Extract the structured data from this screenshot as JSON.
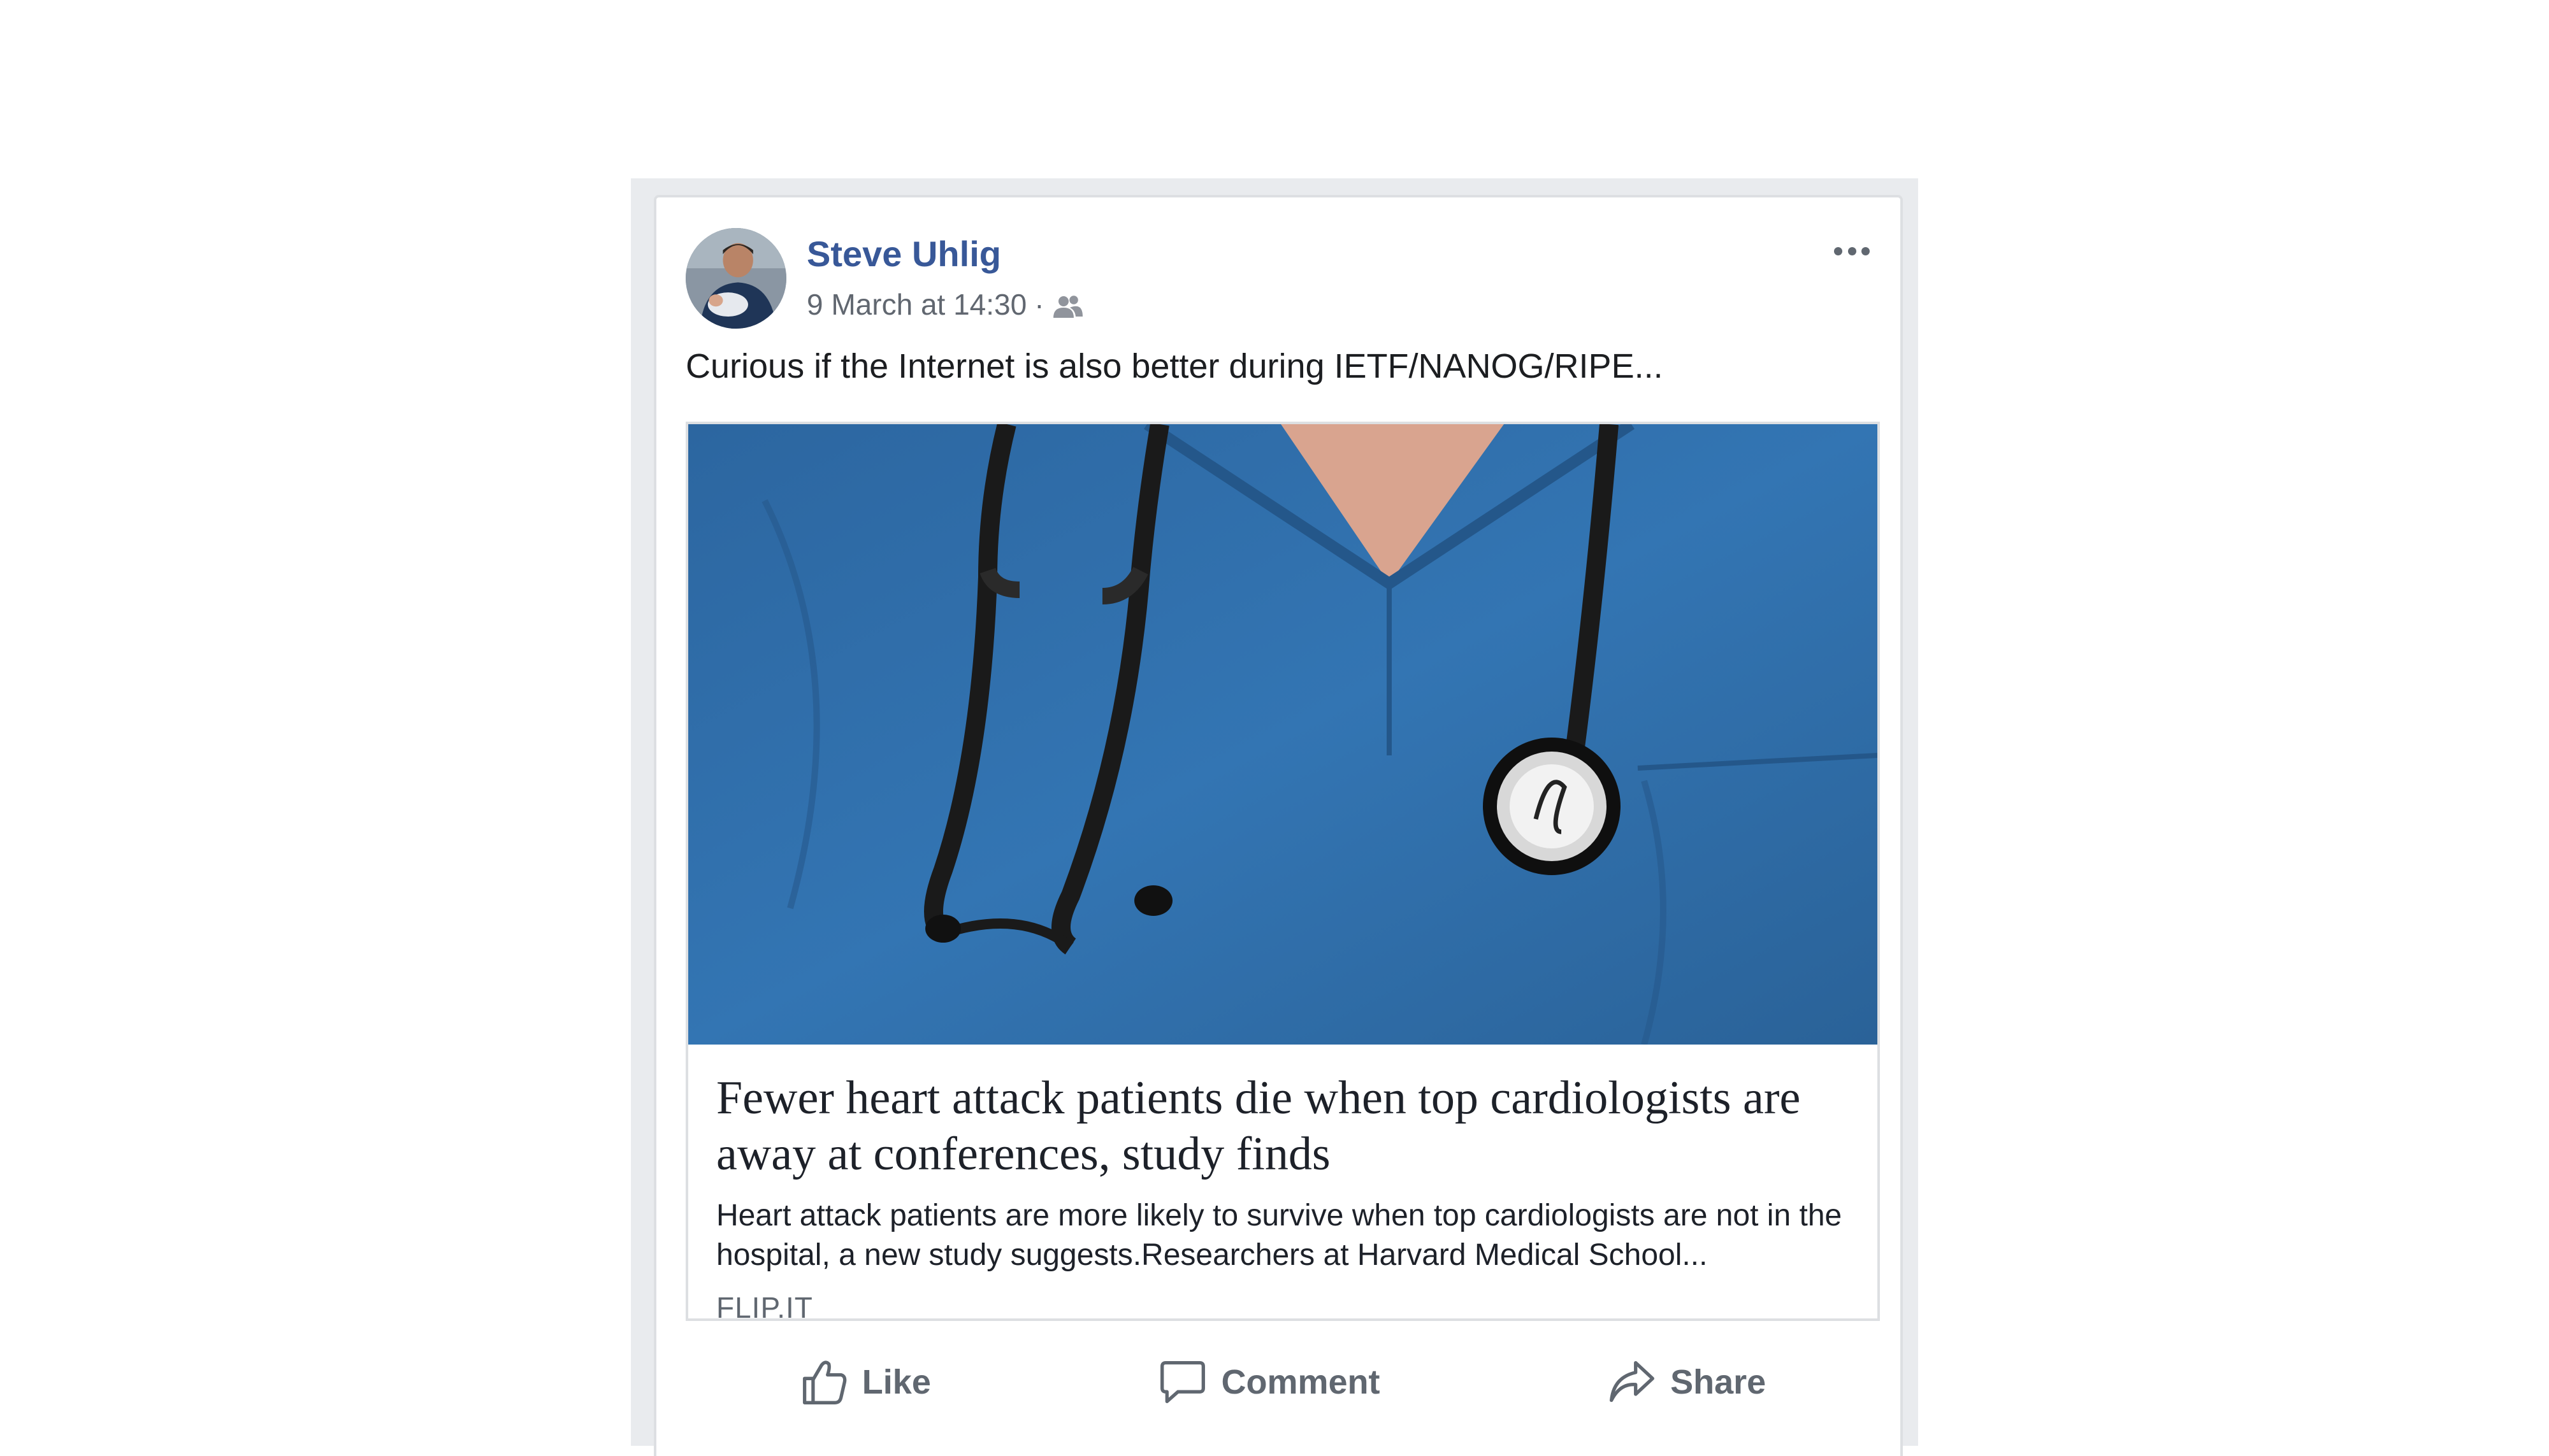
{
  "post": {
    "author": "Steve Uhlig",
    "timestamp": "9 March at 14:30",
    "separator": "·",
    "audience_icon": "friends-icon",
    "more_icon": "more-options-icon",
    "text": "Curious if the Internet is also better during IETF/NANOG/RIPE..."
  },
  "link_preview": {
    "title": "Fewer heart attack patients die when top cardiologists are away at conferences, study finds",
    "description": "Heart attack patients are more likely to survive when top cardiologists are not in the hospital, a new study suggests.Researchers at Harvard Medical School...",
    "domain": "FLIP.IT"
  },
  "actions": {
    "like": "Like",
    "comment": "Comment",
    "share": "Share"
  },
  "colors": {
    "author_link": "#385898",
    "action_text": "#606770",
    "scrubs_blue": "#2f6ea8",
    "frame_gray": "#e9ebee"
  }
}
